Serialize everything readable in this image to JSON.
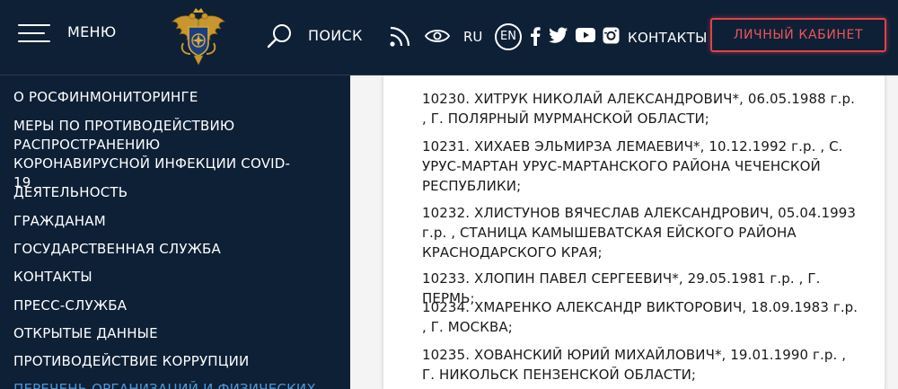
{
  "header": {
    "menu_label": "МЕНЮ",
    "search_label": "ПОИСК",
    "lang_ru": "RU",
    "lang_en": "EN",
    "contacts_label": "КОНТАКТЫ",
    "cabinet_button": "ЛИЧНЫЙ КАБИНЕТ",
    "icons": [
      "menu-icon",
      "emblem-logo",
      "search-icon",
      "rss-icon",
      "eye-icon",
      "facebook-icon",
      "twitter-icon",
      "youtube-icon",
      "instagram-icon"
    ]
  },
  "colors": {
    "header_bg": "#0e2036",
    "sidebar_bg": "#0e2036",
    "accent_red": "#e0424a",
    "active_link": "#4c97d6"
  },
  "sidebar": {
    "items": [
      {
        "label": "О РОСФИНМОНИТОРИНГЕ"
      },
      {
        "label": "МЕРЫ ПО ПРОТИВОДЕЙСТВИЮ РАСПРОСТРАНЕНИЮ КОРОНАВИРУСНОЙ ИНФЕКЦИИ COVID-19"
      },
      {
        "label": "ДЕЯТЕЛЬНОСТЬ"
      },
      {
        "label": "ГРАЖДАНАМ"
      },
      {
        "label": "ГОСУДАРСТВЕННАЯ СЛУЖБА"
      },
      {
        "label": "КОНТАКТЫ"
      },
      {
        "label": "ПРЕСС-СЛУЖБА"
      },
      {
        "label": "ОТКРЫТЫЕ ДАННЫЕ"
      },
      {
        "label": "ПРОТИВОДЕЙСТВИЕ КОРРУПЦИИ"
      },
      {
        "label": "ПЕРЕЧЕНЬ ОРГАНИЗАЦИЙ И ФИЗИЧЕСКИХ"
      }
    ]
  },
  "content": {
    "entries": [
      {
        "text": "10230. ХИТРУК НИКОЛАЙ АЛЕКСАНДРОВИЧ*, 06.05.1988 г.р. , Г. ПОЛЯРНЫЙ МУРМАНСКОЙ ОБЛАСТИ;"
      },
      {
        "text": "10231. ХИХАЕВ ЭЛЬМИРЗА ЛЕМАЕВИЧ*, 10.12.1992 г.р. , С. УРУС-МАРТАН УРУС-МАРТАНСКОГО РАЙОНА ЧЕЧЕНСКОЙ РЕСПУБЛИКИ;"
      },
      {
        "text": "10232. ХЛИСТУНОВ ВЯЧЕСЛАВ АЛЕКСАНДРОВИЧ, 05.04.1993 г.р. , СТАНИЦА КАМЫШЕВАТСКАЯ ЕЙСКОГО РАЙОНА КРАСНОДАРСКОГО КРАЯ;"
      },
      {
        "text": "10233. ХЛОПИН ПАВЕЛ СЕРГЕЕВИЧ*, 29.05.1981 г.р. , Г. ПЕРМЬ;"
      },
      {
        "text": "10234. ХМАРЕНКО АЛЕКСАНДР ВИКТОРОВИЧ, 18.09.1983 г.р. , Г. МОСКВА;"
      },
      {
        "text": "10235. ХОВАНСКИЙ ЮРИЙ МИХАЙЛОВИЧ*, 19.01.1990 г.р. , Г. НИКОЛЬСК ПЕНЗЕНСКОЙ ОБЛАСТИ;"
      }
    ]
  }
}
